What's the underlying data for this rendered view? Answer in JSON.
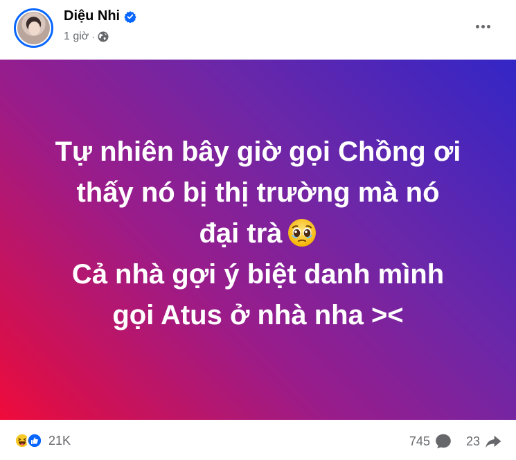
{
  "post": {
    "author_name": "Diệu Nhi",
    "time": "1 giờ",
    "separator": "·",
    "content_lines": [
      "Tự nhiên bây giờ gọi Chồng ơi",
      "thấy nó bị thị trường mà nó",
      "đại trà",
      "Cả nhà gợi ý biệt danh mình",
      "gọi Atus ở nhà nha ><"
    ],
    "background_gradient": [
      "#3326c6",
      "#9a1c8a",
      "#f00b3b"
    ],
    "inline_emoji": "pleading-face"
  },
  "footer": {
    "reaction_count": "21K",
    "reaction_icons": [
      "haha-icon",
      "like-icon"
    ],
    "comment_count": "745",
    "share_count": "23"
  },
  "colors": {
    "accent": "#0866ff",
    "meta_text": "#65676b"
  }
}
